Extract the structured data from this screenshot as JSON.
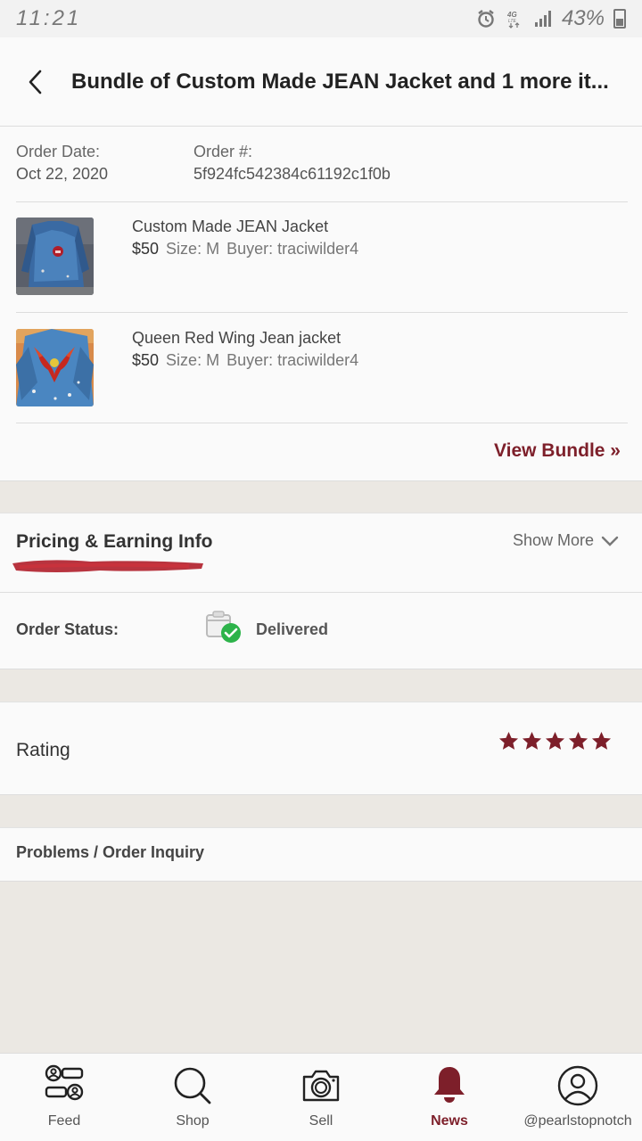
{
  "status_bar": {
    "time": "11:21",
    "battery": "43%",
    "network_label": "4G LTE"
  },
  "header": {
    "title": "Bundle of Custom Made JEAN Jacket and 1 more it..."
  },
  "order": {
    "date_label": "Order Date:",
    "date_value": "Oct 22, 2020",
    "number_label": "Order #:",
    "number_value": "5f924fc542384c61192c1f0b",
    "items": [
      {
        "title": "Custom Made JEAN Jacket",
        "price": "$50",
        "size": "Size: M",
        "buyer": "Buyer: traciwilder4"
      },
      {
        "title": "Queen Red Wing Jean jacket",
        "price": "$50",
        "size": "Size: M",
        "buyer": "Buyer: traciwilder4"
      }
    ],
    "view_bundle_label": "View Bundle »"
  },
  "pricing": {
    "title": "Pricing & Earning Info",
    "show_more_label": "Show More"
  },
  "order_status": {
    "label": "Order Status:",
    "value": "Delivered"
  },
  "rating": {
    "label": "Rating",
    "stars": 5,
    "max_stars": 5
  },
  "problems": {
    "label": "Problems / Order Inquiry"
  },
  "tabs": [
    {
      "label": "Feed",
      "icon": "feed-icon",
      "active": false
    },
    {
      "label": "Shop",
      "icon": "search-icon",
      "active": false
    },
    {
      "label": "Sell",
      "icon": "camera-icon",
      "active": false
    },
    {
      "label": "News",
      "icon": "bell-icon",
      "active": true
    },
    {
      "label": "@pearlstopnotch",
      "icon": "profile-icon",
      "active": false
    }
  ],
  "colors": {
    "accent": "#7d1f2a",
    "success": "#2db34a",
    "background": "#ebe8e3"
  }
}
